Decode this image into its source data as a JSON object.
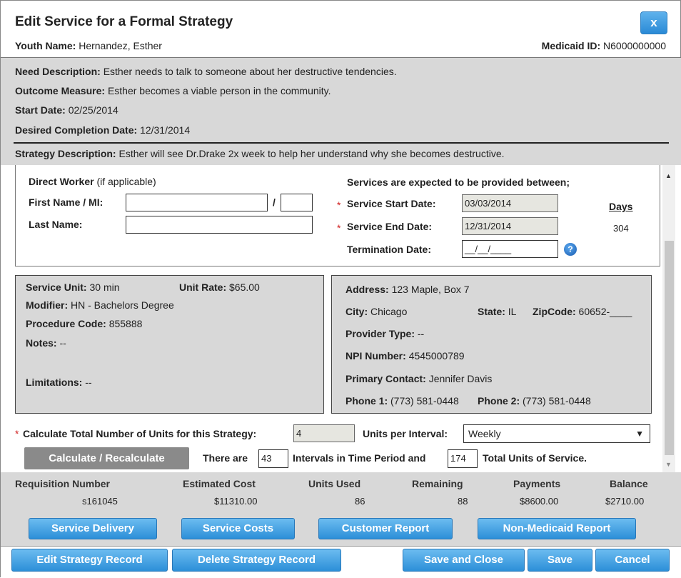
{
  "dialog": {
    "title": "Edit Service for a Formal Strategy",
    "close_label": "x",
    "youth_name_label": "Youth Name:",
    "youth_name": "Hernandez, Esther",
    "medicaid_label": "Medicaid ID:",
    "medicaid_id": "N6000000000"
  },
  "info": {
    "need_label": "Need Description:",
    "need": "Esther needs to talk to someone about her destructive tendencies.",
    "outcome_label": "Outcome Measure:",
    "outcome": "Esther becomes a viable person in the community.",
    "start_label": "Start Date:",
    "start": "02/25/2014",
    "desired_label": "Desired Completion Date:",
    "desired": "12/31/2014",
    "strategy_label": "Strategy Description:",
    "strategy": "Esther will see Dr.Drake 2x week to help her understand why she becomes destructive."
  },
  "worker": {
    "heading": "Direct Worker",
    "heading_note": "(if applicable)",
    "first_label": "First Name / MI:",
    "slash": "/",
    "last_label": "Last Name:",
    "first_value": "",
    "mi_value": "",
    "last_value": ""
  },
  "dates": {
    "heading": "Services are expected to be provided between;",
    "required_mark": "*",
    "start_label": "Service Start Date:",
    "start_value": "03/03/2014",
    "end_label": "Service End Date:",
    "end_value": "12/31/2014",
    "term_label": "Termination Date:",
    "term_value": "__/__/____",
    "days_label": "Days",
    "days_value": "304",
    "help_icon": "?"
  },
  "service": {
    "unit_label": "Service Unit:",
    "unit": "30 min",
    "rate_label": "Unit Rate:",
    "rate": "$65.00",
    "modifier_label": "Modifier:",
    "modifier": "HN - Bachelors Degree",
    "procedure_label": "Procedure Code:",
    "procedure": "855888",
    "notes_label": "Notes:",
    "notes": "--",
    "limitations_label": "Limitations:",
    "limitations": "--"
  },
  "provider": {
    "address_label": "Address:",
    "address": "123 Maple, Box 7",
    "city_label": "City:",
    "city": "Chicago",
    "state_label": "State:",
    "state": "IL",
    "zip_label": "ZipCode:",
    "zip": "60652-____",
    "type_label": "Provider Type:",
    "type": "--",
    "npi_label": "NPI Number:",
    "npi": "4545000789",
    "contact_label": "Primary Contact:",
    "contact": "Jennifer Davis",
    "phone1_label": "Phone 1:",
    "phone1": "(773) 581-0448",
    "phone2_label": "Phone 2:",
    "phone2": "(773) 581-0448"
  },
  "calc": {
    "required_mark": "*",
    "total_label": "Calculate Total Number of Units for this Strategy:",
    "total_value": "4",
    "per_interval_label": "Units per Interval:",
    "per_interval_value": "Weekly",
    "button": "Calculate / Recalculate",
    "there_are": "There are",
    "intervals_value": "43",
    "intervals_text": "Intervals in Time Period and",
    "total_units_value": "174",
    "total_units_text": "Total Units of Service."
  },
  "summary": {
    "headers": [
      "Requisition Number",
      "Estimated Cost",
      "Units Used",
      "Remaining",
      "Payments",
      "Balance"
    ],
    "values": [
      "s161045",
      "$11310.00",
      "86",
      "88",
      "$8600.00",
      "$2710.00"
    ]
  },
  "report_buttons": {
    "service_delivery": "Service Delivery",
    "service_costs": "Service Costs",
    "customer_report": "Customer Report",
    "non_medicaid": "Non-Medicaid Report"
  },
  "footer_buttons": {
    "edit": "Edit Strategy Record",
    "delete": "Delete Strategy Record",
    "save_close": "Save and Close",
    "save": "Save",
    "cancel": "Cancel"
  }
}
